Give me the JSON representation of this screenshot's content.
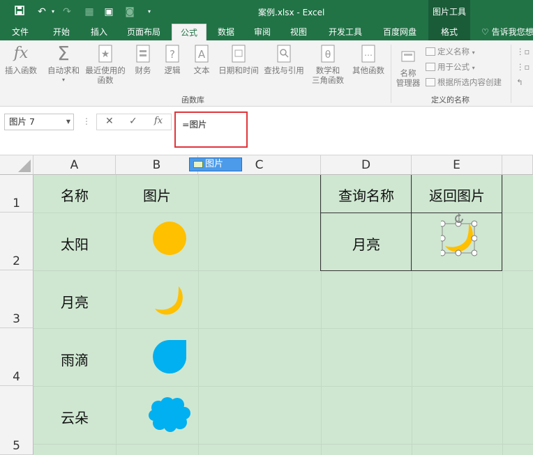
{
  "window": {
    "title": "案例.xlsx - Excel",
    "context_title": "图片工具"
  },
  "quick_access": {
    "save_icon": "save-icon",
    "undo_icon": "undo-icon",
    "redo_icon": "redo-icon"
  },
  "tabs": [
    "文件",
    "开始",
    "插入",
    "页面布局",
    "公式",
    "数据",
    "审阅",
    "视图",
    "开发工具",
    "百度网盘",
    "格式"
  ],
  "active_tab": "公式",
  "tell_me": "告诉我您想",
  "ribbon": {
    "buttons": [
      "插入函数",
      "自动求和",
      "最近使用的",
      "函数",
      "财务",
      "逻辑",
      "文本",
      "日期和时间",
      "查找与引用",
      "数学和",
      "三角函数",
      "其他函数",
      "名称",
      "管理器"
    ],
    "group_label_functions": "函数库",
    "group_label_names": "定义的名称",
    "small_items": [
      "定义名称",
      "用于公式",
      "根据所选内容创建"
    ]
  },
  "formula_bar": {
    "name_box": "图片 7",
    "formula": "=图片"
  },
  "name_tooltip": "图片",
  "columns": [
    "A",
    "B",
    "C",
    "D",
    "E"
  ],
  "rows": [
    "1",
    "2",
    "3",
    "4",
    "5"
  ],
  "cells": {
    "A1": "名称",
    "B1": "图片",
    "A2": "太阳",
    "A3": "月亮",
    "A4": "雨滴",
    "A5": "云朵",
    "D1": "查询名称",
    "E1": "返回图片",
    "D2": "月亮"
  },
  "colors": {
    "excel_green": "#217346",
    "sheet_fill": "#cfe7d1",
    "sun": "#ffc000",
    "blue": "#00b0f0",
    "highlight_border": "#e0343a"
  }
}
